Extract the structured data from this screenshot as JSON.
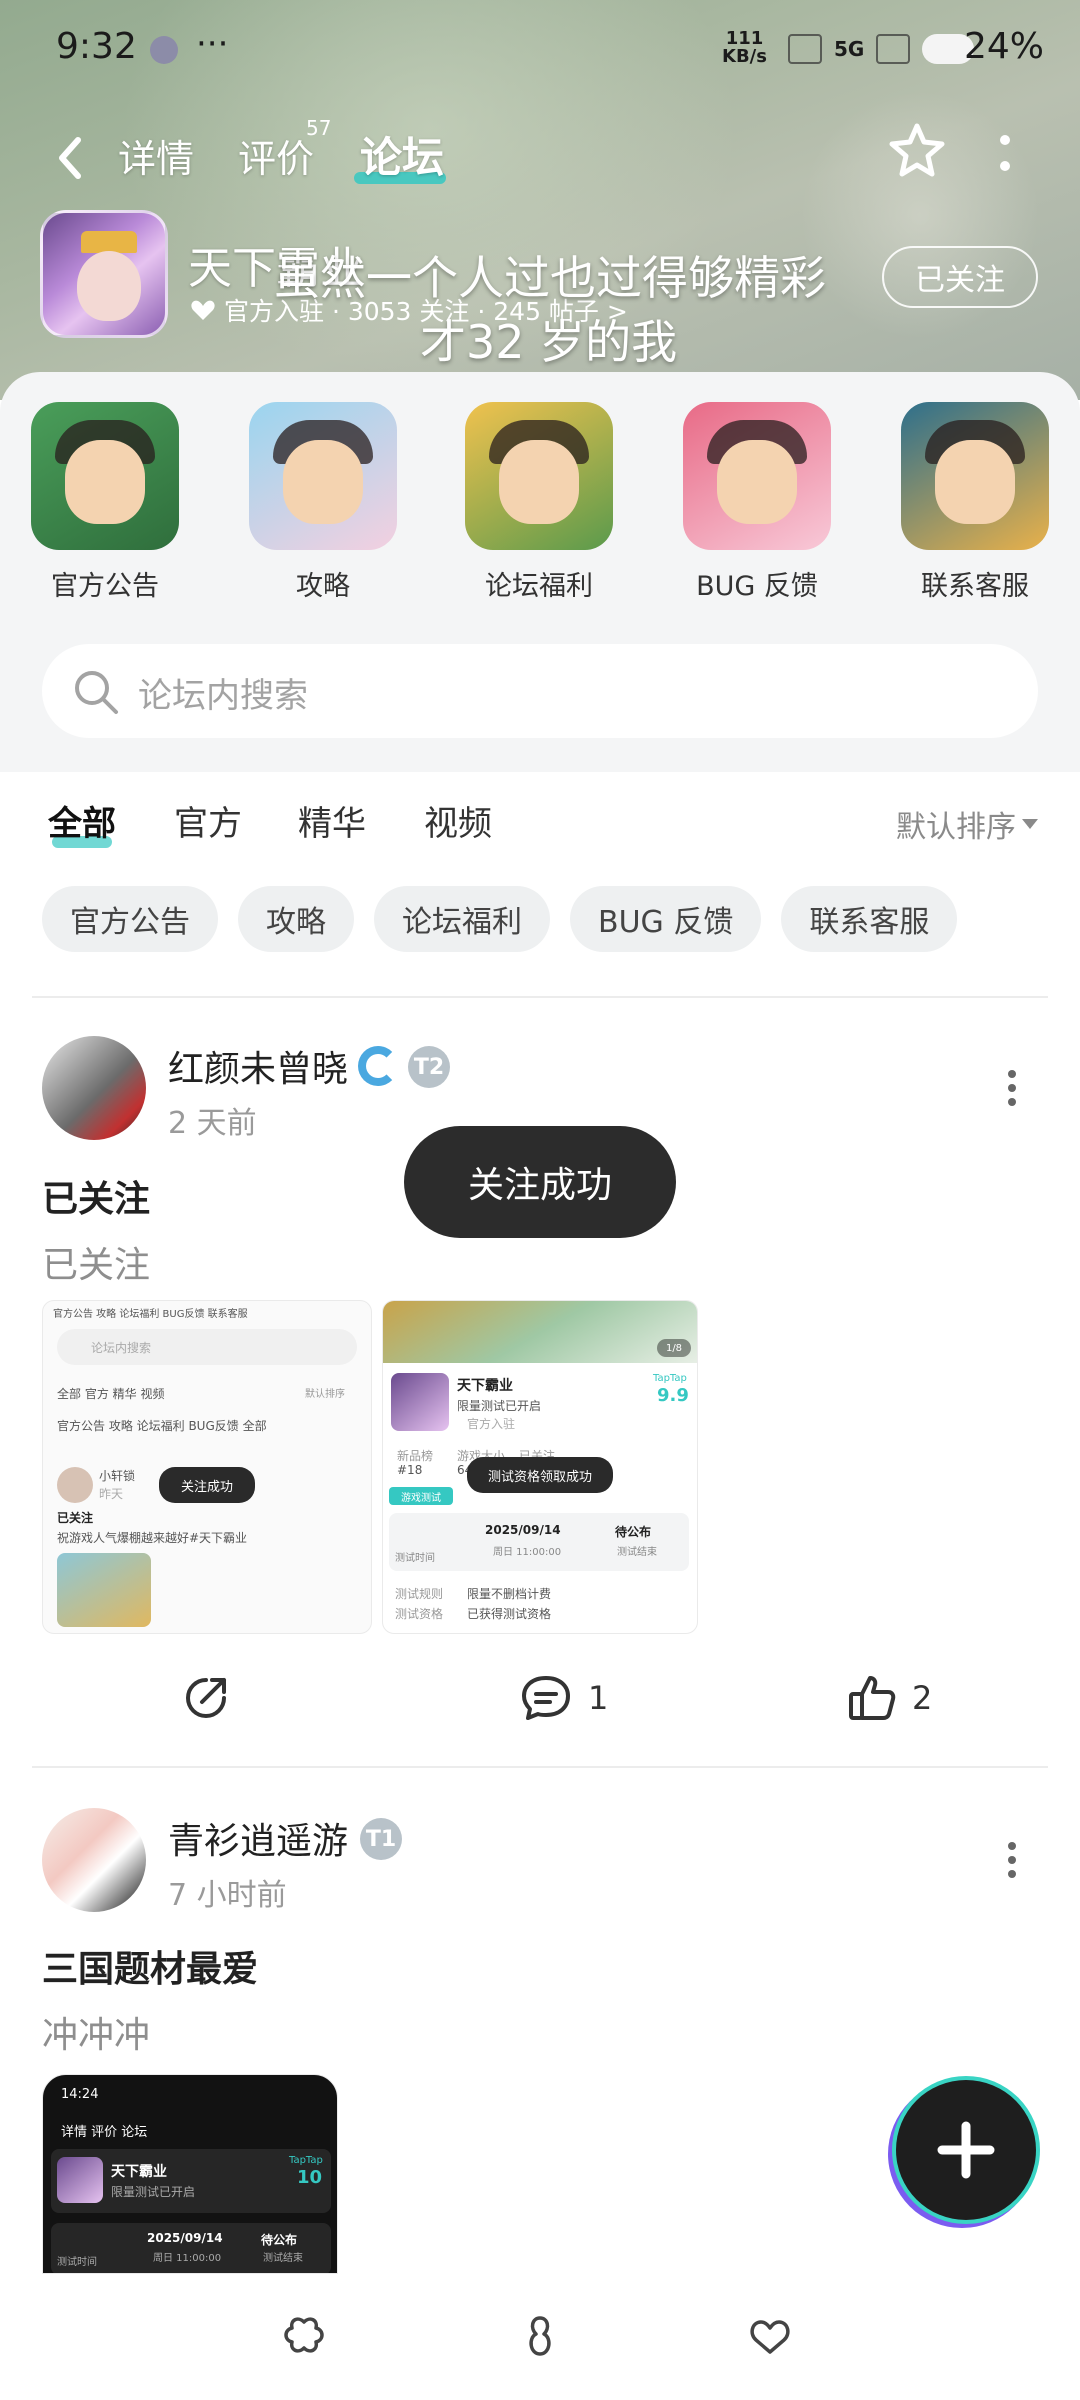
{
  "status_bar": {
    "time": "9:32",
    "dots": "···",
    "net_speed_top": "111",
    "net_speed_bottom": "KB/s",
    "signal": "5G",
    "battery": "24%"
  },
  "top_nav": {
    "tabs": [
      {
        "label": "详情"
      },
      {
        "label": "评价",
        "sup": "57"
      },
      {
        "label": "论坛"
      }
    ]
  },
  "forum": {
    "title": "天下霸业",
    "meta": "官方入驻 · 3053 关注 · 245 帖子 >",
    "follow_button": "已关注",
    "overlay_line_1": "虽然一个人过也过得够精彩",
    "overlay_line_2": "才32 岁的我"
  },
  "quick_links": [
    {
      "label": "官方公告"
    },
    {
      "label": "攻略"
    },
    {
      "label": "论坛福利"
    },
    {
      "label": "BUG 反馈"
    },
    {
      "label": "联系客服"
    }
  ],
  "search": {
    "placeholder": "论坛内搜索"
  },
  "filters": {
    "tabs": [
      {
        "label": "全部"
      },
      {
        "label": "官方"
      },
      {
        "label": "精华"
      },
      {
        "label": "视频"
      }
    ],
    "sort": "默认排序"
  },
  "chips": [
    {
      "label": "官方公告"
    },
    {
      "label": "攻略"
    },
    {
      "label": "论坛福利"
    },
    {
      "label": "BUG 反馈"
    },
    {
      "label": "联系客服"
    }
  ],
  "posts": [
    {
      "author": "红颜未曾晓",
      "level": "T2",
      "time": "2 天前",
      "title": "已关注",
      "body": "已关注",
      "comments": "1",
      "likes": "2",
      "thumb_a": {
        "tabs": "官方公告   攻略   论坛福利   BUG反馈   联系客服",
        "search": "论坛内搜索",
        "filters": "全部   官方   精华   视频",
        "sort": "默认排序",
        "chips": "官方公告   攻略   论坛福利   BUG反馈   全部",
        "user": "小轩锁",
        "time": "昨天",
        "toast": "关注成功",
        "title": "已关注",
        "body": "祝游戏人气爆棚越来越好#天下霸业"
      },
      "thumb_b": {
        "counter": "1/8",
        "name": "天下霸业",
        "sub": "限量测试已开启",
        "official": "官方入驻",
        "score_brand": "TapTap",
        "score": "9.9",
        "rank_label": "新品榜",
        "rank": "#18",
        "size_label": "游戏大小",
        "size": "64",
        "follow": "已关注",
        "toast": "测试资格领取成功",
        "test_tag": "游戏测试",
        "test_time_label": "测试时间",
        "date": "2025/09/14",
        "date_sub": "周日 11:00:00",
        "pending": "待公布",
        "pending_sub": "测试结束",
        "rule_label": "测试规则",
        "rule": "限量不删档计费",
        "qual_label": "测试资格",
        "qual": "已获得测试资格"
      }
    },
    {
      "author": "青衫逍遥游",
      "level": "T1",
      "time": "7 小时前",
      "title": "三国题材最爱",
      "body": "冲冲冲",
      "thumb_c": {
        "time": "14:24",
        "tabs": "详情  评价  论坛",
        "name": "天下霸业",
        "sub": "限量测试已开启",
        "score_brand": "TapTap",
        "score": "10",
        "test_time_label": "测试时间",
        "date": "2025/09/14",
        "date_sub": "周日 11:00:00",
        "pending": "待公布",
        "pending_sub": "测试结束"
      }
    }
  ],
  "toast": "关注成功",
  "colors": {
    "accent": "#35c8c2",
    "toast_bg": "#2c2c2c"
  }
}
